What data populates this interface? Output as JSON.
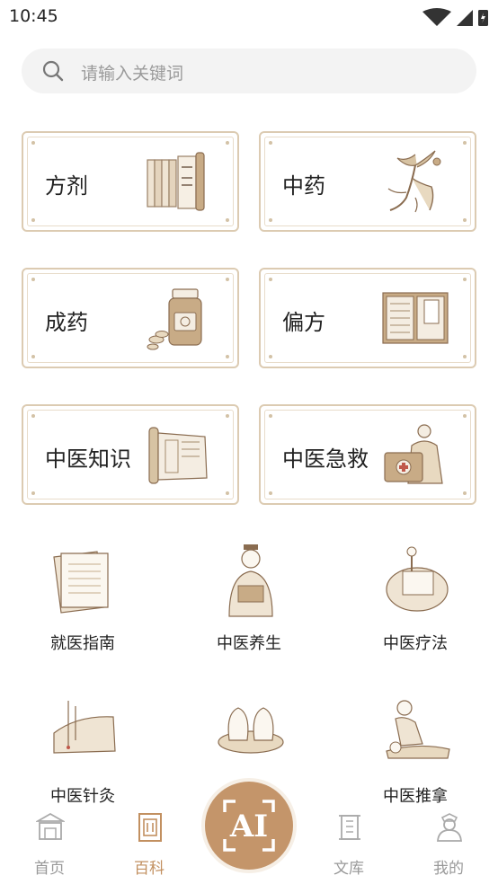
{
  "status_bar": {
    "time": "10:45"
  },
  "search": {
    "placeholder": "请输入关键词"
  },
  "cards": [
    {
      "label": "方剂",
      "icon": "scroll-books-icon"
    },
    {
      "label": "中药",
      "icon": "ginseng-icon"
    },
    {
      "label": "成药",
      "icon": "medicine-jar-icon"
    },
    {
      "label": "偏方",
      "icon": "open-book-icon"
    },
    {
      "label": "中医知识",
      "icon": "scroll-icon"
    },
    {
      "label": "中医急救",
      "icon": "first-aid-doctor-icon"
    }
  ],
  "grid": [
    {
      "label": "就医指南",
      "icon": "papers-icon"
    },
    {
      "label": "中医养生",
      "icon": "scholar-reading-icon"
    },
    {
      "label": "中医疗法",
      "icon": "massage-therapy-icon"
    },
    {
      "label": "中医针灸",
      "icon": "acupuncture-icon"
    },
    {
      "label": "",
      "icon": "cupping-icon"
    },
    {
      "label": "中医推拿",
      "icon": "tuina-massage-icon"
    }
  ],
  "tabs": [
    {
      "label": "首页",
      "icon": "home-building-icon",
      "active": false
    },
    {
      "label": "百科",
      "icon": "scroll-icon",
      "active": true
    },
    {
      "label": "文库",
      "icon": "library-scroll-icon",
      "active": false
    },
    {
      "label": "我的",
      "icon": "person-icon",
      "active": false
    }
  ],
  "ai_button": {
    "text": "AI"
  },
  "colors": {
    "accent": "#c29060",
    "card_border": "#dccbb2",
    "ai_bg": "#c4956a"
  }
}
